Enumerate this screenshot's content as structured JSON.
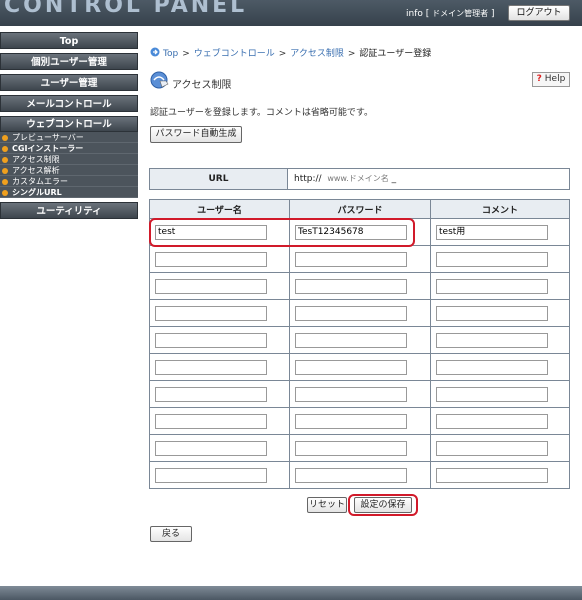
{
  "header": {
    "logo": "CONTROL PANEL",
    "user": "info",
    "domain_admin": "ドメイン管理者",
    "logout": "ログアウト"
  },
  "sidebar": {
    "items": [
      {
        "label": "Top"
      },
      {
        "label": "個別ユーザー管理"
      },
      {
        "label": "ユーザー管理"
      },
      {
        "label": "メールコントロール"
      },
      {
        "label": "ウェブコントロール"
      }
    ],
    "sub_items": [
      {
        "label": "プレビューサーバー"
      },
      {
        "label": "CGIインストーラー"
      },
      {
        "label": "アクセス制限"
      },
      {
        "label": "アクセス解析"
      },
      {
        "label": "カスタムエラー"
      },
      {
        "label": "シングルURL"
      }
    ],
    "utility": "ユーティリティ"
  },
  "breadcrumb": {
    "items": [
      "Top",
      "ウェブコントロール",
      "アクセス制限"
    ],
    "separator": ">",
    "current": "認証ユーザー登録"
  },
  "page": {
    "title": "アクセス制限",
    "help": "Help",
    "description": "認証ユーザーを登録します。コメントは省略可能です。",
    "generate_button": "パスワード自動生成"
  },
  "url_row": {
    "label": "URL",
    "prefix": "http://",
    "domain": "www.ドメイン名",
    "suffix": "_"
  },
  "table": {
    "headers": [
      "ユーザー名",
      "パスワード",
      "コメント"
    ],
    "rows": [
      {
        "user": "test",
        "password": "TesT12345678",
        "comment": "test用"
      },
      {
        "user": "",
        "password": "",
        "comment": ""
      },
      {
        "user": "",
        "password": "",
        "comment": ""
      },
      {
        "user": "",
        "password": "",
        "comment": ""
      },
      {
        "user": "",
        "password": "",
        "comment": ""
      },
      {
        "user": "",
        "password": "",
        "comment": ""
      },
      {
        "user": "",
        "password": "",
        "comment": ""
      },
      {
        "user": "",
        "password": "",
        "comment": ""
      },
      {
        "user": "",
        "password": "",
        "comment": ""
      },
      {
        "user": "",
        "password": "",
        "comment": ""
      }
    ]
  },
  "actions": {
    "reset": "リセット",
    "save": "設定の保存",
    "back": "戻る"
  },
  "colors": {
    "accent": "#3a6fb0",
    "highlight": "#d11a2a",
    "header_bg": "#3d4852",
    "sidebar_bg": "#4c545c"
  }
}
